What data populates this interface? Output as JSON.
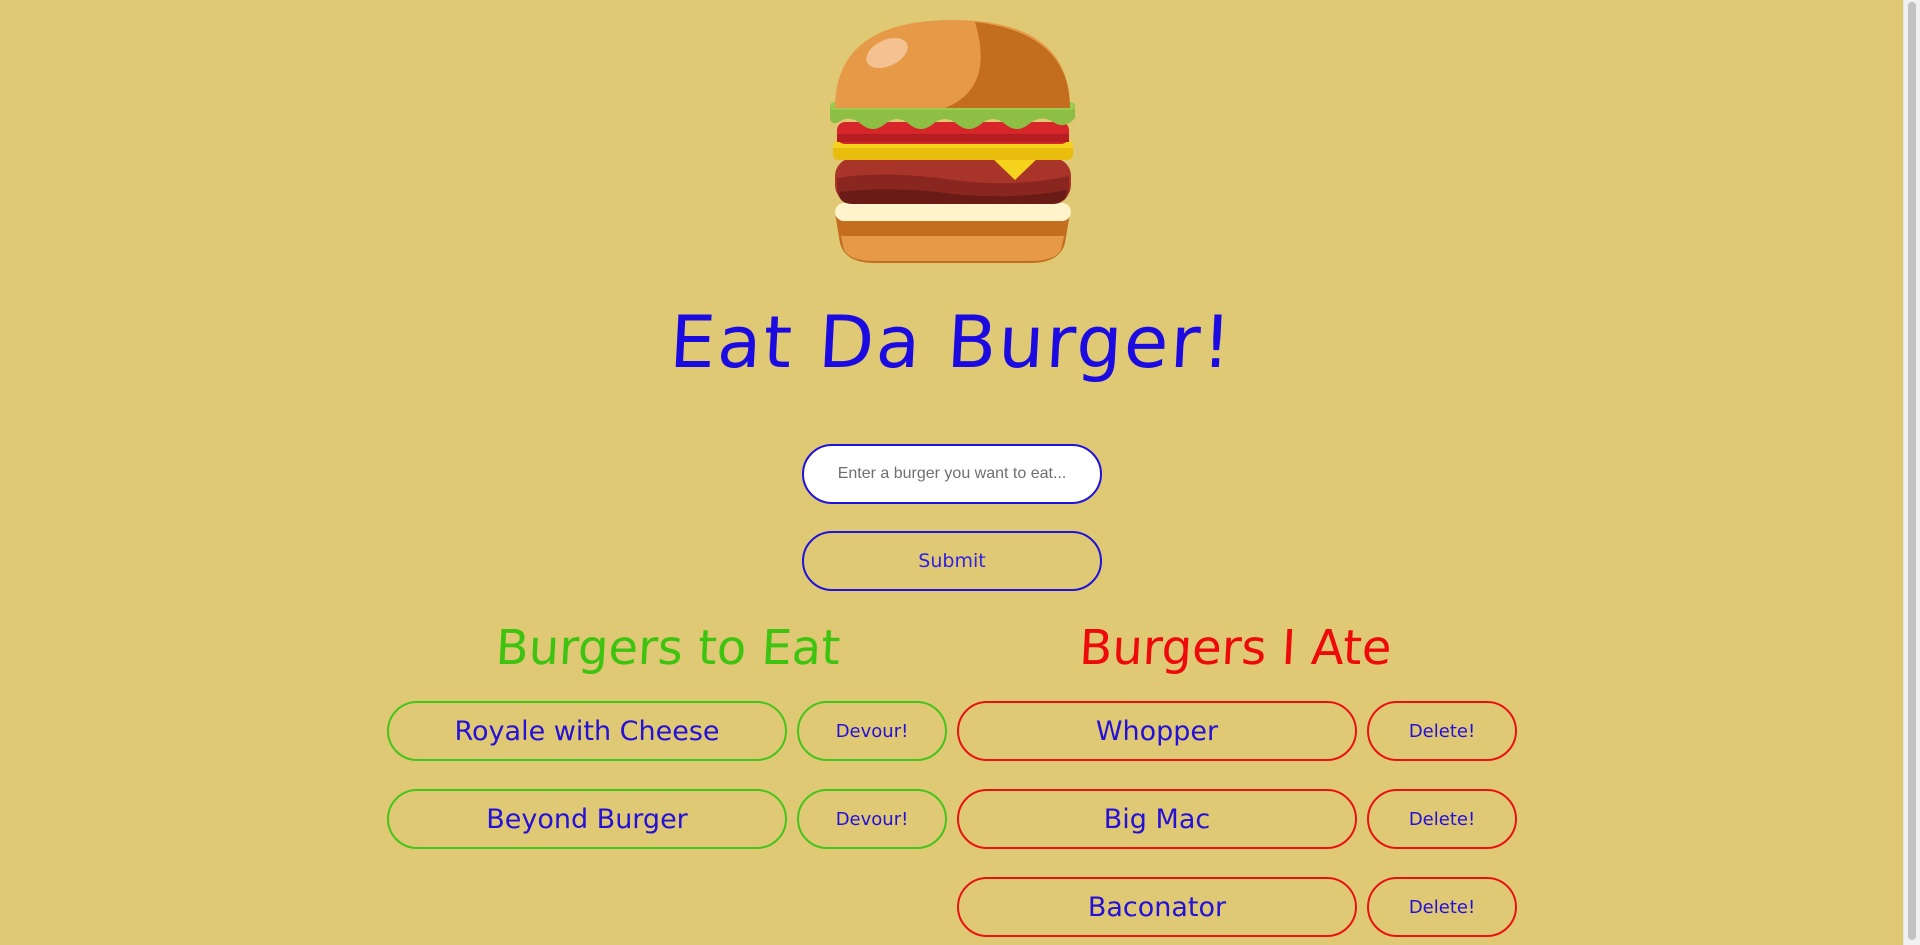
{
  "header": {
    "title": "Eat Da Burger!"
  },
  "form": {
    "placeholder": "Enter a burger you want to eat...",
    "value": "",
    "submit_label": "Submit"
  },
  "columns": {
    "to_eat_heading": "Burgers to Eat",
    "ate_heading": "Burgers I Ate"
  },
  "to_eat": [
    {
      "name": "Royale with Cheese",
      "action": "Devour!"
    },
    {
      "name": "Beyond Burger",
      "action": "Devour!"
    }
  ],
  "ate": [
    {
      "name": "Whopper",
      "action": "Delete!"
    },
    {
      "name": "Big Mac",
      "action": "Delete!"
    },
    {
      "name": "Baconator",
      "action": "Delete!"
    }
  ],
  "colors": {
    "background": "#e0c975",
    "primary_blue": "#1f12dc",
    "to_eat_green": "#45c41b",
    "ate_red": "#e81212"
  },
  "icons": {
    "logo": "burger-icon"
  }
}
